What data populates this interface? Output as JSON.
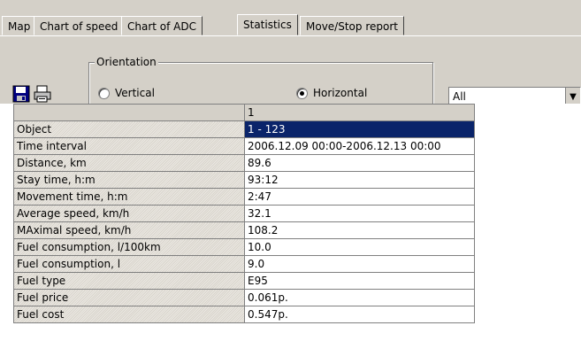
{
  "tabs": [
    "Map",
    "Chart of speed",
    "Chart of ADC",
    "Statistics",
    "Move/Stop report"
  ],
  "active_tab": "Statistics",
  "toolbar": {
    "save_icon": "floppy-disk-icon",
    "print_icon": "printer-icon"
  },
  "orientation": {
    "label": "Orientation",
    "vertical": "Vertical",
    "horizontal": "Horizontal",
    "selected": "Horizontal"
  },
  "filter": {
    "value": "All"
  },
  "table": {
    "column_header": "1",
    "rows": [
      {
        "label": "Object",
        "value": "1 - 123"
      },
      {
        "label": "Time interval",
        "value": "2006.12.09 00:00-2006.12.13 00:00"
      },
      {
        "label": "Distance, km",
        "value": "89.6"
      },
      {
        "label": "Stay time, h:m",
        "value": "93:12"
      },
      {
        "label": "Movement time, h:m",
        "value": "2:47"
      },
      {
        "label": "Average speed, km/h",
        "value": "32.1"
      },
      {
        "label": "MAximal speed, km/h",
        "value": "108.2"
      },
      {
        "label": "Fuel consumption, l/100km",
        "value": "10.0"
      },
      {
        "label": "Fuel consumption, l",
        "value": "9.0"
      },
      {
        "label": "Fuel type",
        "value": "E95"
      },
      {
        "label": "Fuel price",
        "value": "0.061p."
      },
      {
        "label": "Fuel cost",
        "value": "0.547p."
      }
    ]
  }
}
